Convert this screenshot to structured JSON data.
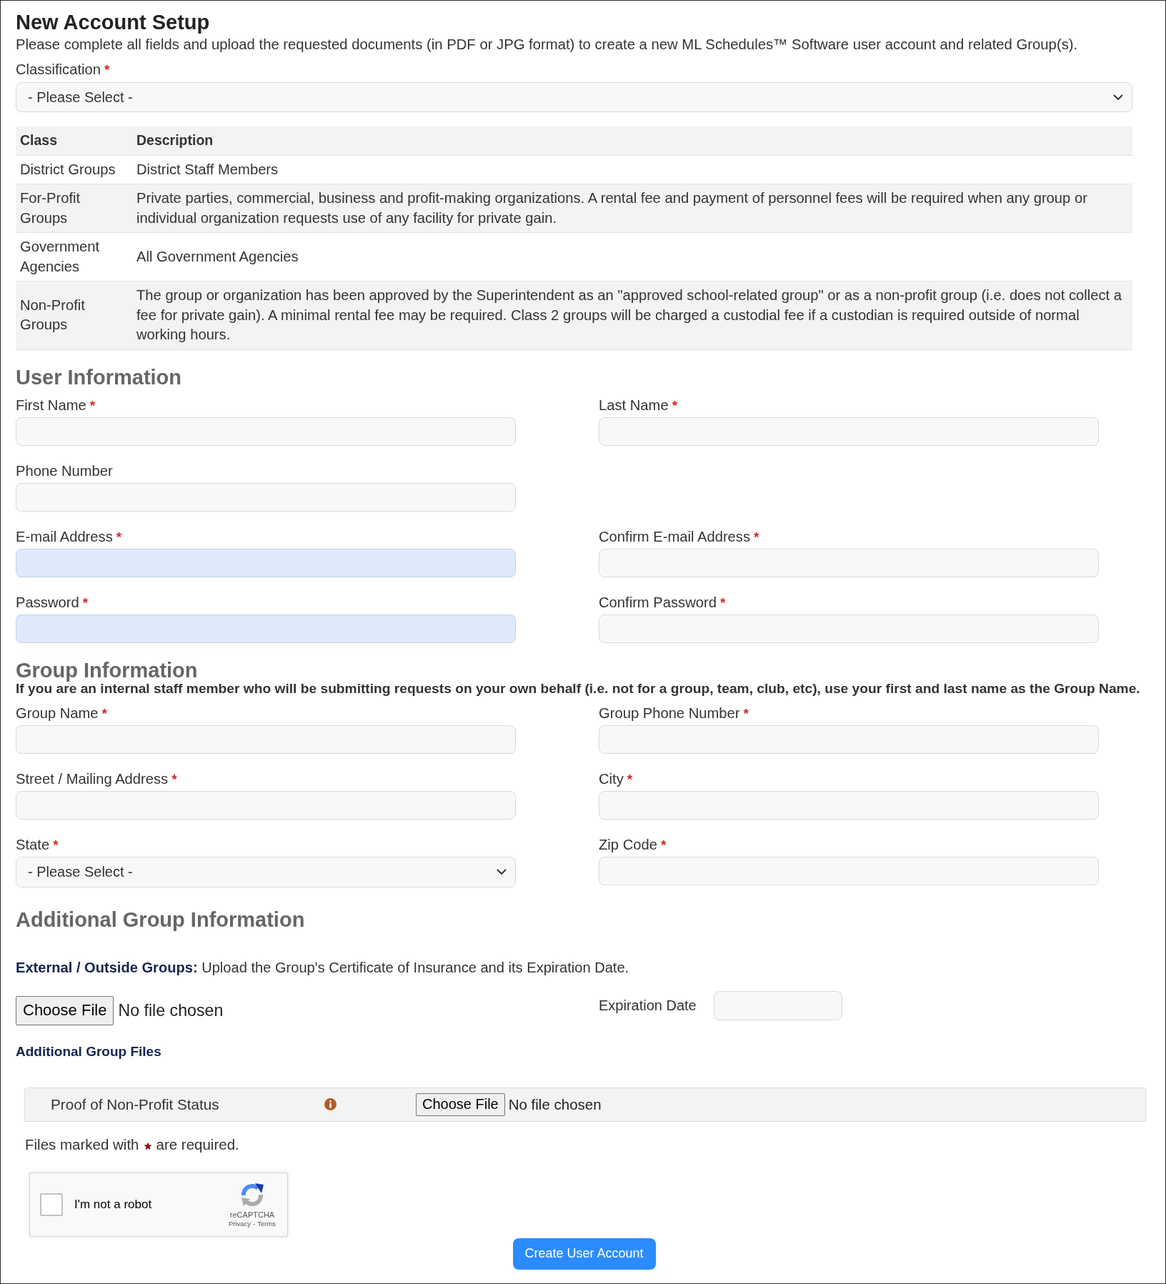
{
  "header": {
    "title": "New Account Setup",
    "intro": "Please complete all fields and upload the requested documents (in PDF or JPG format) to create a new ML Schedules™ Software user account and related Group(s)."
  },
  "classification": {
    "label": "Classification",
    "required_mark": "*",
    "value": "- Please Select -"
  },
  "class_table": {
    "columns": [
      "Class",
      "Description"
    ],
    "rows": [
      [
        "District Groups",
        "District Staff Members"
      ],
      [
        "For-Profit Groups",
        "Private parties, commercial, business and profit-making organizations. A rental fee and payment of personnel fees will be required when any group or individual organization requests use of any facility for private gain."
      ],
      [
        "Government Agencies",
        "All Government Agencies"
      ],
      [
        "Non-Profit Groups",
        "The group or organization has been approved by the Superintendent as an \"approved school-related group\" or as a non-profit group (i.e. does not collect a fee for private gain). A minimal rental fee may be required. Class 2 groups will be charged a custodial fee if a custodian is required outside of normal working hours."
      ]
    ]
  },
  "user_information": {
    "heading": "User Information",
    "rows": [
      [
        {
          "label": "First Name",
          "required_mark": "*",
          "kind": "text",
          "autofilled": false
        },
        {
          "label": "Last Name",
          "required_mark": "*",
          "kind": "text",
          "autofilled": false
        }
      ],
      [
        {
          "label": "Phone Number",
          "kind": "text",
          "autofilled": false
        }
      ],
      [
        {
          "label": "E-mail Address",
          "required_mark": "*",
          "kind": "text",
          "autofilled": true
        },
        {
          "label": "Confirm E-mail Address",
          "required_mark": "*",
          "kind": "text",
          "autofilled": false
        }
      ],
      [
        {
          "label": "Password",
          "required_mark": "*",
          "kind": "text",
          "autofilled": true
        },
        {
          "label": "Confirm Password",
          "required_mark": "*",
          "kind": "text",
          "autofilled": false
        }
      ]
    ]
  },
  "group_information": {
    "heading": "Group Information",
    "note": "If you are an internal staff member who will be submitting requests on your own behalf (i.e. not for a group, team, club, etc), use your first and last name as the Group Name.",
    "rows": [
      [
        {
          "label": "Group Name",
          "required_mark": "*",
          "kind": "text",
          "autofilled": false
        },
        {
          "label": "Group Phone Number",
          "required_mark": "*",
          "kind": "text",
          "autofilled": false
        }
      ],
      [
        {
          "label": "Street / Mailing Address",
          "required_mark": "*",
          "kind": "text",
          "autofilled": false
        },
        {
          "label": "City",
          "required_mark": "*",
          "kind": "text",
          "autofilled": false
        }
      ],
      [
        {
          "label": "State",
          "required_mark": "*",
          "kind": "select",
          "value": "- Please Select -",
          "autofilled": false
        },
        {
          "label": "Zip Code",
          "required_mark": "*",
          "kind": "text",
          "autofilled": false
        }
      ]
    ]
  },
  "additional_group_information": {
    "heading": "Additional Group Information",
    "instruction": "**External / Outside Groups:** Upload the Group's Certificate of Insurance and its Expiration Date.",
    "certificate_file": {
      "button": "Choose File",
      "status": "No file chosen"
    },
    "expiration_date": {
      "label": "Expiration Date"
    },
    "files_heading": "Additional Group Files",
    "files": [
      {
        "label": "Proof of Non-Profit Status",
        "button": "Choose File",
        "status": "No file chosen"
      }
    ],
    "required_note": {
      "before": "Files marked with",
      "after": "are required."
    }
  },
  "captcha": {
    "label": "I'm not a robot",
    "checked": false,
    "brand": "reCAPTCHA",
    "privacy_link": "Privacy",
    "separator": "-",
    "terms_link": "Terms"
  },
  "submit_button": "Create User Account"
}
